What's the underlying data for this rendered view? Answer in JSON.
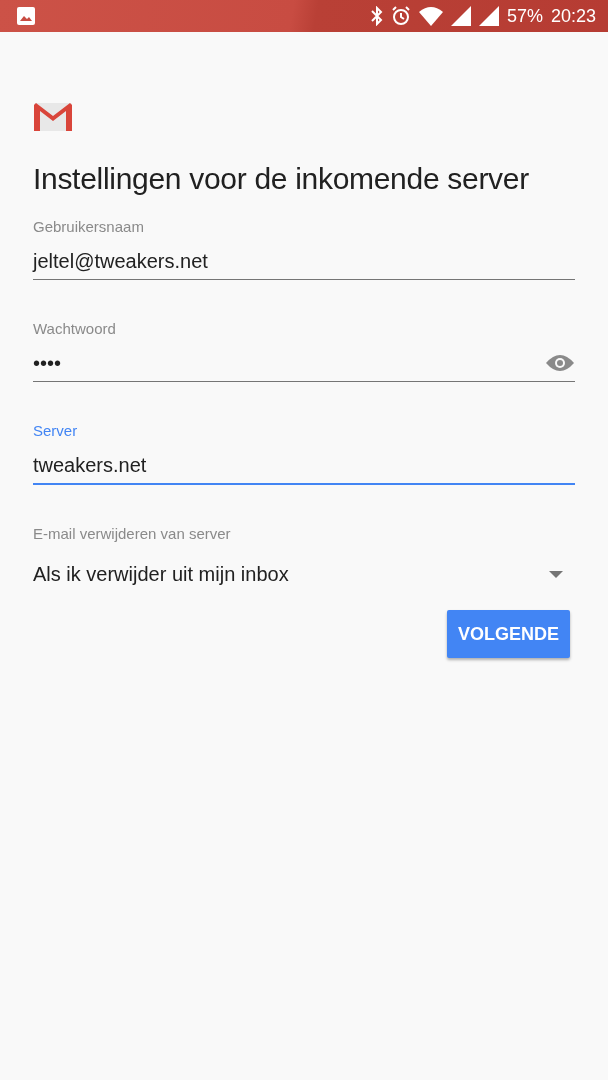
{
  "status_bar": {
    "battery": "57%",
    "time": "20:23"
  },
  "title": "Instellingen voor de inkomende server",
  "fields": [
    {
      "kind": "text",
      "label": "Gebruikersnaam",
      "value": "jeltel@tweakers.net",
      "focused": false
    },
    {
      "kind": "password",
      "label": "Wachtwoord",
      "value": "••••",
      "focused": false
    },
    {
      "kind": "text",
      "label": "Server",
      "value": "tweakers.net",
      "focused": true
    }
  ],
  "dropdown": {
    "label": "E-mail verwijderen van server",
    "value": "Als ik verwijder uit mijn inbox"
  },
  "buttons": [
    "VOLGENDE"
  ]
}
